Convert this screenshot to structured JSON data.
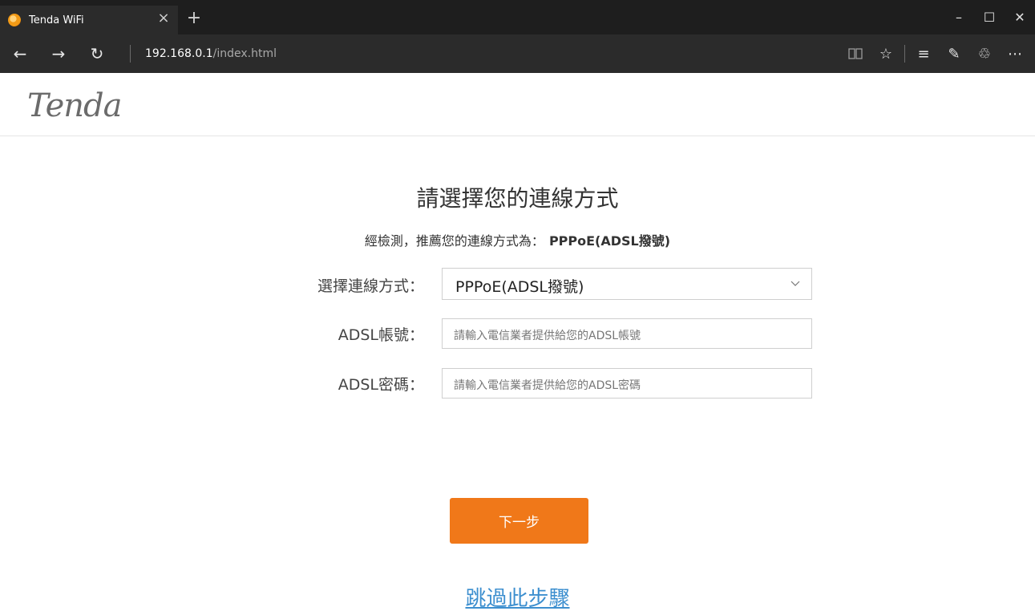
{
  "browser": {
    "tab_title": "Tenda WiFi",
    "address_host": "192.168.0.1",
    "address_path": "/index.html"
  },
  "icons": {
    "tab_close": "×",
    "new_tab": "+",
    "minimize": "–",
    "maximize": "☐",
    "close": "✕",
    "back": "←",
    "forward": "→",
    "refresh": "↻",
    "reading_view": "📖",
    "favorite": "☆",
    "hub": "≡",
    "web_note": "✎",
    "share": "♲",
    "more": "⋯",
    "caret": "﹀"
  },
  "header": {
    "logo": "Tenda"
  },
  "main": {
    "title": "請選擇您的連線方式",
    "detect_prefix": "經檢測，推薦您的連線方式為：",
    "detect_value": "PPPoE(ADSL撥號)"
  },
  "form": {
    "mode_label": "選擇連線方式：",
    "mode_value": "PPPoE(ADSL撥號)",
    "account_label": "ADSL帳號：",
    "account_placeholder": "請輸入電信業者提供給您的ADSL帳號",
    "password_label": "ADSL密碼：",
    "password_placeholder": "請輸入電信業者提供給您的ADSL密碼"
  },
  "actions": {
    "next": "下一步",
    "skip": "跳過此步驟"
  },
  "colors": {
    "accent": "#f07819",
    "link": "#3d8fcf"
  }
}
